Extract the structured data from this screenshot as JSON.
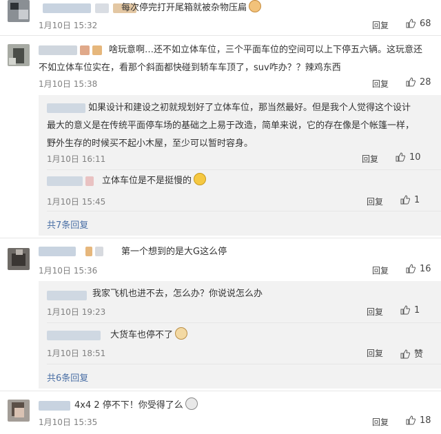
{
  "comments": [
    {
      "text": "每次停完打开尾箱就被杂物压扁",
      "date": "1月10日 15:32",
      "reply_label": "回复",
      "likes": "68"
    },
    {
      "text_lines": [
        "啥玩意啊…还不如立体车位，三个平面车位的空间可以上下停五六辆。这玩意还",
        "不如立体车位实在，看那个斜面都快碰到轿车车顶了，suv咋办？？辣鸡东西"
      ],
      "date": "1月10日 15:38",
      "reply_label": "回复",
      "likes": "28",
      "replies": [
        {
          "text_lines": [
            "如果设计和建设之初就规划好了立体车位，那当然最好。但是我个人觉得这个设计",
            "最大的意义是在传统平面停车场的基础之上易于改造，简单来说，它的存在像是个帐篷一样，",
            "野外生存的时候买不起小木屋，至少可以暂时容身。"
          ],
          "date": "1月10日 16:11",
          "reply_label": "回复",
          "likes": "10"
        },
        {
          "text": "立体车位是不是挺慢的",
          "date": "1月10日 15:45",
          "reply_label": "回复",
          "likes": "1"
        }
      ],
      "more_label": "共7条回复"
    },
    {
      "text": "第一个想到的是大G这么停",
      "date": "1月10日 15:36",
      "reply_label": "回复",
      "likes": "16",
      "replies": [
        {
          "text": "我家飞机也进不去，怎么办？你说说怎么办",
          "date": "1月10日 19:23",
          "reply_label": "回复",
          "likes": "1"
        },
        {
          "text": "大货车也停不了",
          "date": "1月10日 18:51",
          "reply_label": "回复",
          "likes": "赞"
        }
      ],
      "more_label": "共6条回复"
    },
    {
      "text": "4x4 2 停不下！你受得了么",
      "date": "1月10日 15:35",
      "reply_label": "回复",
      "likes": "18"
    }
  ]
}
